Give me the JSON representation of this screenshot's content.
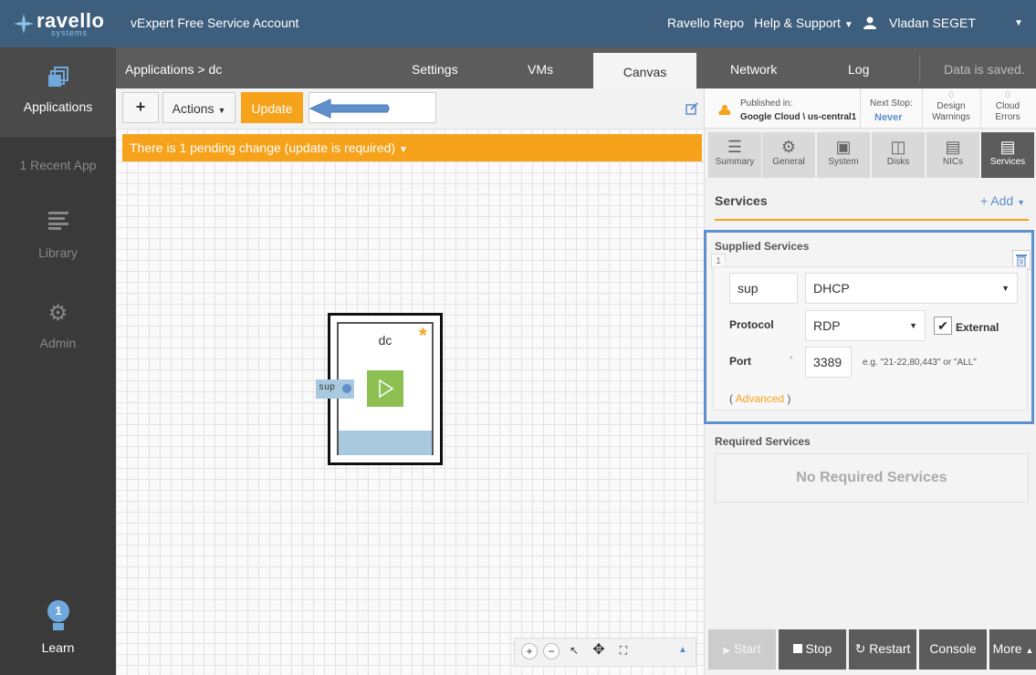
{
  "topbar": {
    "logo": "ravello",
    "logo_sub": "systems",
    "account": "vExpert Free Service Account",
    "repo": "Ravello Repo",
    "help": "Help & Support",
    "user": "Vladan SEGET"
  },
  "sidebar": {
    "applications": "Applications",
    "recent": "1 Recent App",
    "library": "Library",
    "admin": "Admin",
    "learn": "Learn",
    "learn_badge": "1"
  },
  "header": {
    "breadcrumb": "Applications > dc",
    "tabs": [
      "Settings",
      "VMs",
      "Canvas",
      "Network",
      "Log"
    ],
    "active_tab": "Canvas",
    "status": "Data is saved."
  },
  "toolbar": {
    "add": "+",
    "actions": "Actions",
    "update": "Update"
  },
  "canvas": {
    "pending": "There is 1 pending change (update is required)",
    "vm_name": "dc",
    "vm_service": "sup",
    "vm_modified_mark": "*"
  },
  "status_strip": {
    "published_label": "Published in:",
    "published_value": "Google Cloud \\ us-central1",
    "next_stop_label": "Next Stop:",
    "next_stop_value": "Never",
    "design_count": "0",
    "design_label": "Design Warnings",
    "cloud_count": "0",
    "cloud_label": "Cloud Errors"
  },
  "subtabs": [
    "Summary",
    "General",
    "System",
    "Disks",
    "NICs",
    "Services"
  ],
  "services": {
    "title": "Services",
    "add": "+ Add",
    "supplied_title": "Supplied Services",
    "row_index": "1",
    "name": "sup",
    "type": "DHCP",
    "protocol_label": "Protocol",
    "protocol": "RDP",
    "external_label": "External",
    "port_label": "Port",
    "port": "3389",
    "port_hint": "e.g. \"21-22,80,443\" or \"ALL\"",
    "advanced": "Advanced",
    "required_title": "Required Services",
    "required_empty": "No Required Services"
  },
  "actions": {
    "start": "Start",
    "stop": "Stop",
    "restart": "Restart",
    "console": "Console",
    "more": "More"
  },
  "colors": {
    "topbar": "#3d5e7c",
    "accent": "#f7a21b",
    "highlight": "#5f8fcc",
    "vm_green": "#8cc152",
    "vm_blue": "#a8c9de"
  }
}
